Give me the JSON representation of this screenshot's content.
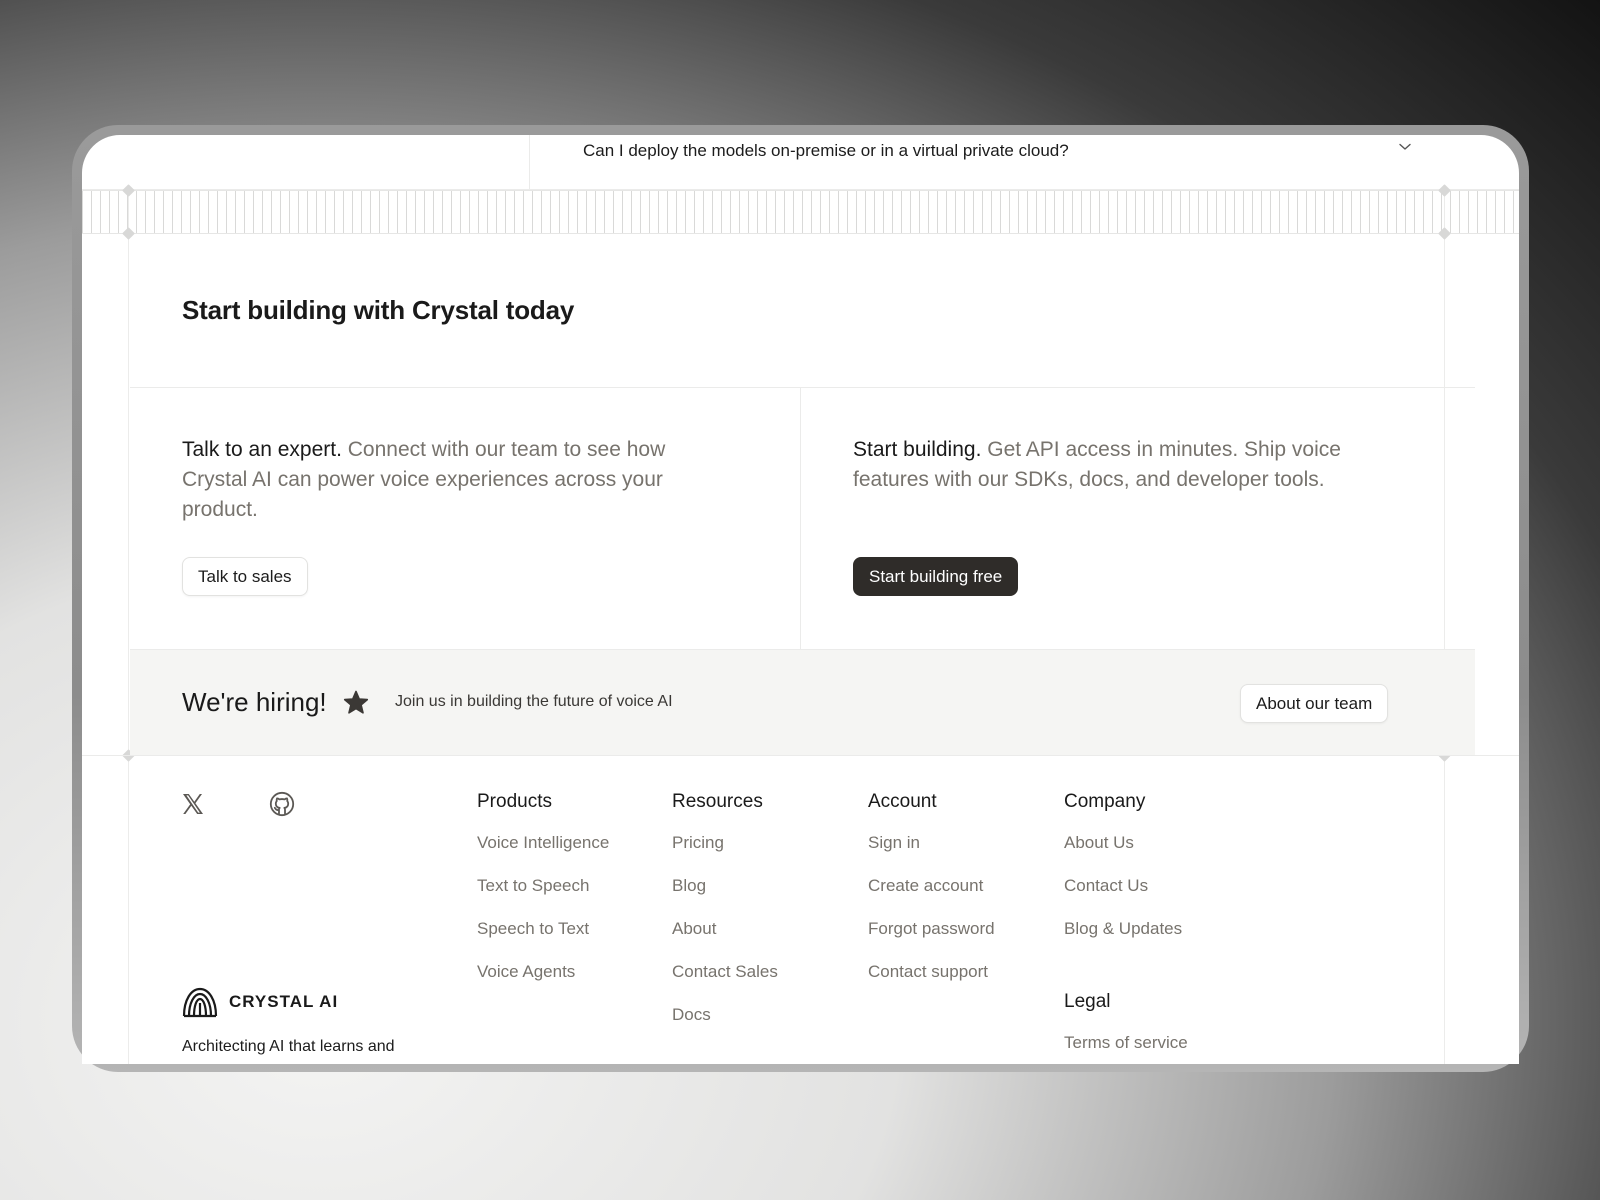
{
  "faq": {
    "question": "Can I deploy the models on-premise or in a virtual private cloud?"
  },
  "cta": {
    "title": "Start building with Crystal today",
    "expert": {
      "lead": "Talk to an expert.",
      "body": " Connect with our team to see how Crystal AI can power voice experiences across your product.",
      "button": "Talk to sales"
    },
    "build": {
      "lead": "Start building.",
      "body": " Get API access in minutes. Ship voice features with our SDKs, docs, and developer tools.",
      "button": "Start building free"
    }
  },
  "hiring": {
    "title": "We're hiring!",
    "text": "Join us in building the future of voice AI",
    "button": "About our team"
  },
  "footer": {
    "columns": [
      {
        "title": "Products",
        "links": [
          "Voice Intelligence",
          "Text to Speech",
          "Speech to Text",
          "Voice Agents"
        ]
      },
      {
        "title": "Resources",
        "links": [
          "Pricing",
          "Blog",
          "About",
          "Contact Sales",
          "Docs"
        ]
      },
      {
        "title": "Account",
        "links": [
          "Sign in",
          "Create account",
          "Forgot password",
          "Contact support"
        ]
      },
      {
        "title": "Company",
        "links": [
          "About Us",
          "Contact Us",
          "Blog & Updates"
        ]
      },
      {
        "title": "Legal",
        "links": [
          "Terms of service"
        ]
      }
    ],
    "brand": {
      "name": "CRYSTAL AI",
      "tagline": "Architecting AI that learns and"
    },
    "icons": {
      "x": "x-logo-icon",
      "github": "github-icon",
      "brand": "crystal-logo-icon",
      "chevron": "chevron-down-icon",
      "star": "star-icon"
    }
  }
}
